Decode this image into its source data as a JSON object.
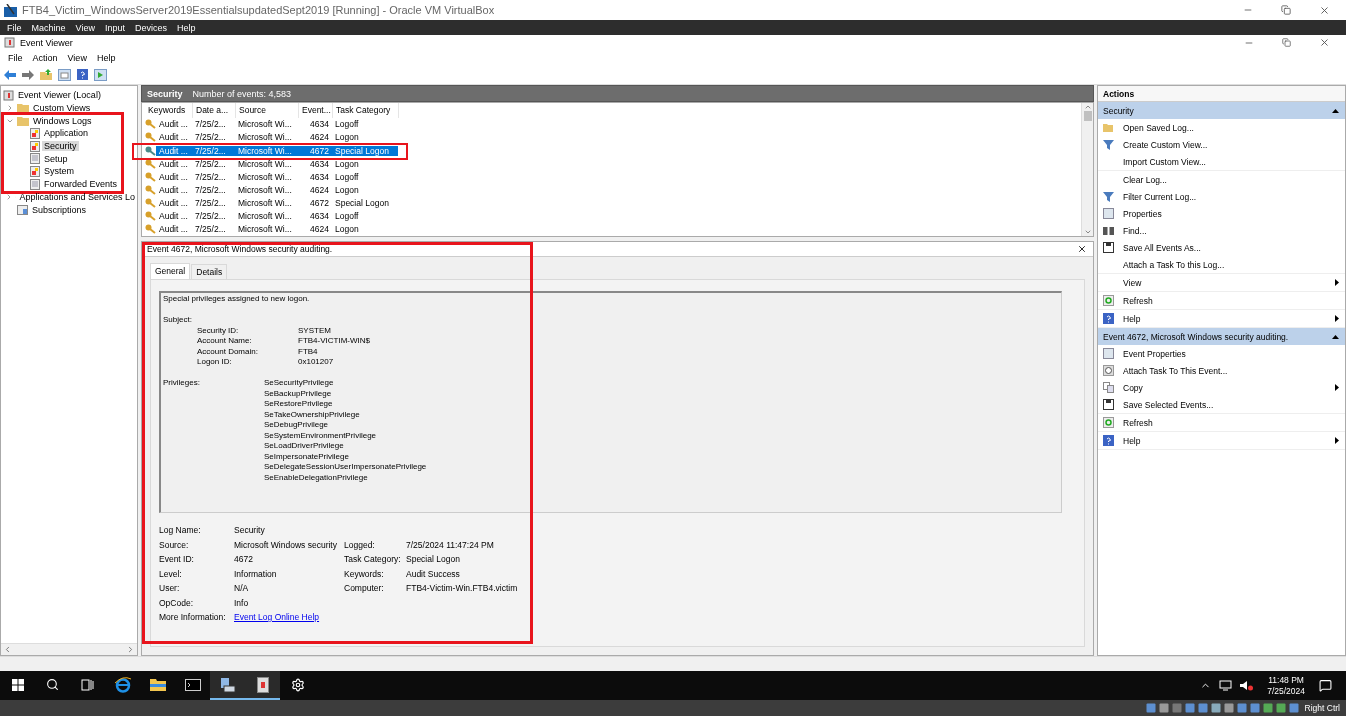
{
  "host": {
    "title": "FTB4_Victim_WindowsServer2019EssentialsupdatedSept2019 [Running] - Oracle VM VirtualBox",
    "menu": [
      "File",
      "Machine",
      "View",
      "Input",
      "Devices",
      "Help"
    ]
  },
  "window": {
    "title": "Event Viewer",
    "menu": [
      "File",
      "Action",
      "View",
      "Help"
    ]
  },
  "tree": [
    {
      "label": "Event Viewer (Local)",
      "kind": "viewer",
      "selected": false,
      "children": [
        {
          "label": "Custom Views",
          "kind": "folder",
          "expanded": false,
          "selected": false
        },
        {
          "label": "Windows Logs",
          "kind": "folder",
          "expanded": true,
          "selected": false,
          "highlighted": true,
          "children": [
            {
              "label": "Application",
              "kind": "log",
              "selected": false
            },
            {
              "label": "Security",
              "kind": "log",
              "selected": true
            },
            {
              "label": "Setup",
              "kind": "plain-log",
              "selected": false
            },
            {
              "label": "System",
              "kind": "log",
              "selected": false
            },
            {
              "label": "Forwarded Events",
              "kind": "plain-log",
              "selected": false
            }
          ]
        },
        {
          "label": "Applications and Services Lo",
          "kind": "folder",
          "expanded": false,
          "selected": false
        },
        {
          "label": "Subscriptions",
          "kind": "subscriptions",
          "selected": false
        }
      ]
    }
  ],
  "log_header": {
    "title": "Security",
    "count": "Number of events: 4,583"
  },
  "events": {
    "columns": [
      "Keywords",
      "Date a...",
      "Source",
      "Event...",
      "Task Category"
    ],
    "rows": [
      {
        "cells": [
          "Audit ...",
          "7/25/2...",
          "Microsoft Wi...",
          "4634",
          "Logoff"
        ],
        "selected": false
      },
      {
        "cells": [
          "Audit ...",
          "7/25/2...",
          "Microsoft Wi...",
          "4624",
          "Logon"
        ],
        "selected": false
      },
      {
        "cells": [
          "Audit ...",
          "7/25/2...",
          "Microsoft Wi...",
          "4672",
          "Special Logon"
        ],
        "selected": true,
        "highlighted": true
      },
      {
        "cells": [
          "Audit ...",
          "7/25/2...",
          "Microsoft Wi...",
          "4634",
          "Logon"
        ],
        "selected": false
      },
      {
        "cells": [
          "Audit ...",
          "7/25/2...",
          "Microsoft Wi...",
          "4634",
          "Logoff"
        ],
        "selected": false
      },
      {
        "cells": [
          "Audit ...",
          "7/25/2...",
          "Microsoft Wi...",
          "4624",
          "Logon"
        ],
        "selected": false
      },
      {
        "cells": [
          "Audit ...",
          "7/25/2...",
          "Microsoft Wi...",
          "4672",
          "Special Logon"
        ],
        "selected": false
      },
      {
        "cells": [
          "Audit ...",
          "7/25/2...",
          "Microsoft Wi...",
          "4634",
          "Logoff"
        ],
        "selected": false
      },
      {
        "cells": [
          "Audit ...",
          "7/25/2...",
          "Microsoft Wi...",
          "4624",
          "Logon"
        ],
        "selected": false
      }
    ]
  },
  "details": {
    "title": "Event 4672, Microsoft Windows security auditing.",
    "highlighted": true,
    "tabs": [
      {
        "label": "General",
        "selected": true
      },
      {
        "label": "Details",
        "selected": false
      }
    ],
    "message": {
      "summary": "Special privileges assigned to new logon.",
      "subject_label": "Subject:",
      "subject": [
        {
          "label": "Security ID:",
          "value": "SYSTEM"
        },
        {
          "label": "Account Name:",
          "value": "FTB4-VICTIM-WIN$"
        },
        {
          "label": "Account Domain:",
          "value": "FTB4"
        },
        {
          "label": "Logon ID:",
          "value": "0x101207"
        }
      ],
      "privileges_label": "Privileges:",
      "privileges": [
        "SeSecurityPrivilege",
        "SeBackupPrivilege",
        "SeRestorePrivilege",
        "SeTakeOwnershipPrivilege",
        "SeDebugPrivilege",
        "SeSystemEnvironmentPrivilege",
        "SeLoadDriverPrivilege",
        "SeImpersonatePrivilege",
        "SeDelegateSessionUserImpersonatePrivilege",
        "SeEnableDelegationPrivilege"
      ]
    },
    "fields": [
      [
        {
          "label": "Log Name:",
          "value": "Security"
        }
      ],
      [
        {
          "label": "Source:",
          "value": "Microsoft Windows security"
        },
        {
          "label": "Logged:",
          "value": "7/25/2024 11:47:24 PM"
        }
      ],
      [
        {
          "label": "Event ID:",
          "value": "4672"
        },
        {
          "label": "Task Category:",
          "value": "Special Logon"
        }
      ],
      [
        {
          "label": "Level:",
          "value": "Information"
        },
        {
          "label": "Keywords:",
          "value": "Audit Success"
        }
      ],
      [
        {
          "label": "User:",
          "value": "N/A"
        },
        {
          "label": "Computer:",
          "value": "FTB4-Victim-Win.FTB4.victim"
        }
      ],
      [
        {
          "label": "OpCode:",
          "value": "Info"
        }
      ]
    ],
    "more_info": {
      "label": "More Information:",
      "link": "Event Log Online Help"
    }
  },
  "actions": {
    "title": "Actions",
    "sections": [
      {
        "title": "Security",
        "expanded": true,
        "groups": [
          [
            {
              "label": "Open Saved Log..."
            },
            {
              "label": "Create Custom View..."
            },
            {
              "label": "Import Custom View..."
            }
          ],
          [
            {
              "label": "Clear Log..."
            },
            {
              "label": "Filter Current Log..."
            },
            {
              "label": "Properties"
            },
            {
              "label": "Find..."
            },
            {
              "label": "Save All Events As..."
            },
            {
              "label": "Attach a Task To this Log..."
            }
          ],
          [
            {
              "label": "View",
              "submenu": true
            }
          ],
          [
            {
              "label": "Refresh"
            }
          ],
          [
            {
              "label": "Help",
              "submenu": true
            }
          ]
        ]
      },
      {
        "title": "Event 4672, Microsoft Windows security auditing.",
        "expanded": true,
        "groups": [
          [
            {
              "label": "Event Properties"
            },
            {
              "label": "Attach Task To This Event..."
            },
            {
              "label": "Copy",
              "submenu": true
            },
            {
              "label": "Save Selected Events..."
            }
          ],
          [
            {
              "label": "Refresh"
            }
          ],
          [
            {
              "label": "Help",
              "submenu": true
            }
          ]
        ]
      }
    ]
  },
  "taskbar": {
    "apps": [
      {
        "kind": "start",
        "active": false
      },
      {
        "kind": "search",
        "active": false
      },
      {
        "kind": "task-view",
        "active": false
      },
      {
        "kind": "browser",
        "active": false
      },
      {
        "kind": "explorer",
        "active": false
      },
      {
        "kind": "terminal",
        "active": false
      },
      {
        "kind": "event-viewer",
        "active": true
      },
      {
        "kind": "app",
        "active": true
      },
      {
        "kind": "settings",
        "active": false
      }
    ],
    "time": "11:48 PM",
    "date": "7/25/2024"
  },
  "host_status": {
    "key": "Right Ctrl"
  }
}
